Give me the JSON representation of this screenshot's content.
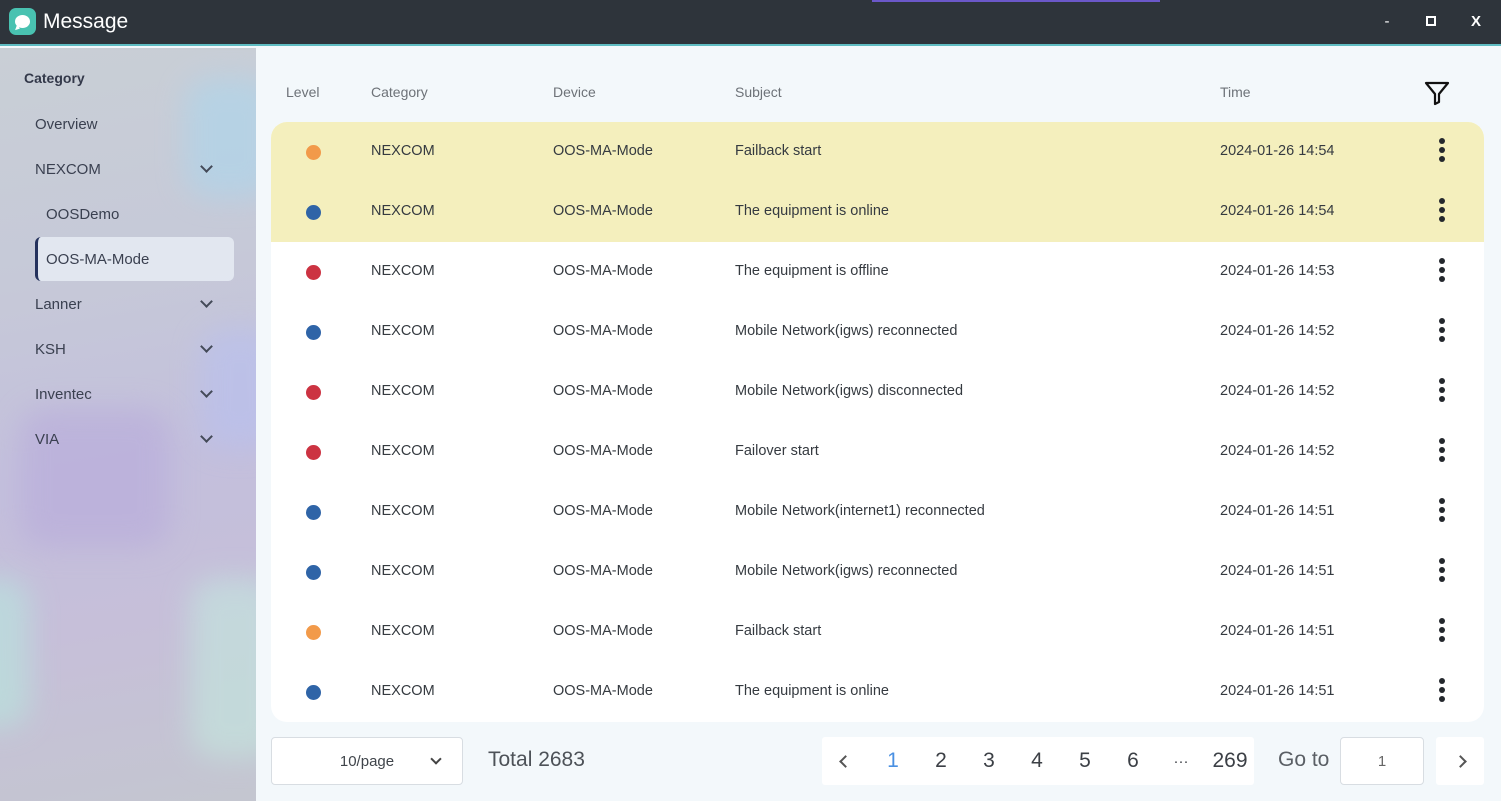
{
  "window": {
    "title": "Message",
    "minimize_label": "-",
    "close_label": "X"
  },
  "sidebar": {
    "heading": "Category",
    "items": [
      {
        "label": "Overview"
      },
      {
        "label": "NEXCOM"
      },
      {
        "label": "OOSDemo"
      },
      {
        "label": "OOS-MA-Mode"
      },
      {
        "label": "Lanner"
      },
      {
        "label": "KSH"
      },
      {
        "label": "Inventec"
      },
      {
        "label": "VIA"
      }
    ]
  },
  "table": {
    "headers": {
      "level": "Level",
      "category": "Category",
      "device": "Device",
      "subject": "Subject",
      "time": "Time"
    },
    "level_colors": {
      "orange": "#f29a4a",
      "blue": "#2f64a7",
      "red": "#cc3342"
    },
    "highlight_color": "#f4efbd",
    "rows": [
      {
        "level": "orange",
        "category": "NEXCOM",
        "device": "OOS-MA-Mode",
        "subject": "Failback start",
        "time": "2024-01-26 14:54",
        "highlighted": true
      },
      {
        "level": "blue",
        "category": "NEXCOM",
        "device": "OOS-MA-Mode",
        "subject": "The equipment is online",
        "time": "2024-01-26 14:54",
        "highlighted": true
      },
      {
        "level": "red",
        "category": "NEXCOM",
        "device": "OOS-MA-Mode",
        "subject": "The equipment is offline",
        "time": "2024-01-26 14:53",
        "highlighted": false
      },
      {
        "level": "blue",
        "category": "NEXCOM",
        "device": "OOS-MA-Mode",
        "subject": "Mobile Network(igws) reconnected",
        "time": "2024-01-26 14:52",
        "highlighted": false
      },
      {
        "level": "red",
        "category": "NEXCOM",
        "device": "OOS-MA-Mode",
        "subject": "Mobile Network(igws) disconnected",
        "time": "2024-01-26 14:52",
        "highlighted": false
      },
      {
        "level": "red",
        "category": "NEXCOM",
        "device": "OOS-MA-Mode",
        "subject": "Failover start",
        "time": "2024-01-26 14:52",
        "highlighted": false
      },
      {
        "level": "blue",
        "category": "NEXCOM",
        "device": "OOS-MA-Mode",
        "subject": "Mobile Network(internet1) reconnected",
        "time": "2024-01-26 14:51",
        "highlighted": false
      },
      {
        "level": "blue",
        "category": "NEXCOM",
        "device": "OOS-MA-Mode",
        "subject": "Mobile Network(igws) reconnected",
        "time": "2024-01-26 14:51",
        "highlighted": false
      },
      {
        "level": "orange",
        "category": "NEXCOM",
        "device": "OOS-MA-Mode",
        "subject": "Failback start",
        "time": "2024-01-26 14:51",
        "highlighted": false
      },
      {
        "level": "blue",
        "category": "NEXCOM",
        "device": "OOS-MA-Mode",
        "subject": "The equipment is online",
        "time": "2024-01-26 14:51",
        "highlighted": false
      }
    ]
  },
  "footer": {
    "per_page": "10/page",
    "total": "Total 2683",
    "pages": [
      "1",
      "2",
      "3",
      "4",
      "5",
      "6",
      "···",
      "269"
    ],
    "current_page": "1",
    "goto_label": "Go to",
    "goto_value": "1"
  }
}
